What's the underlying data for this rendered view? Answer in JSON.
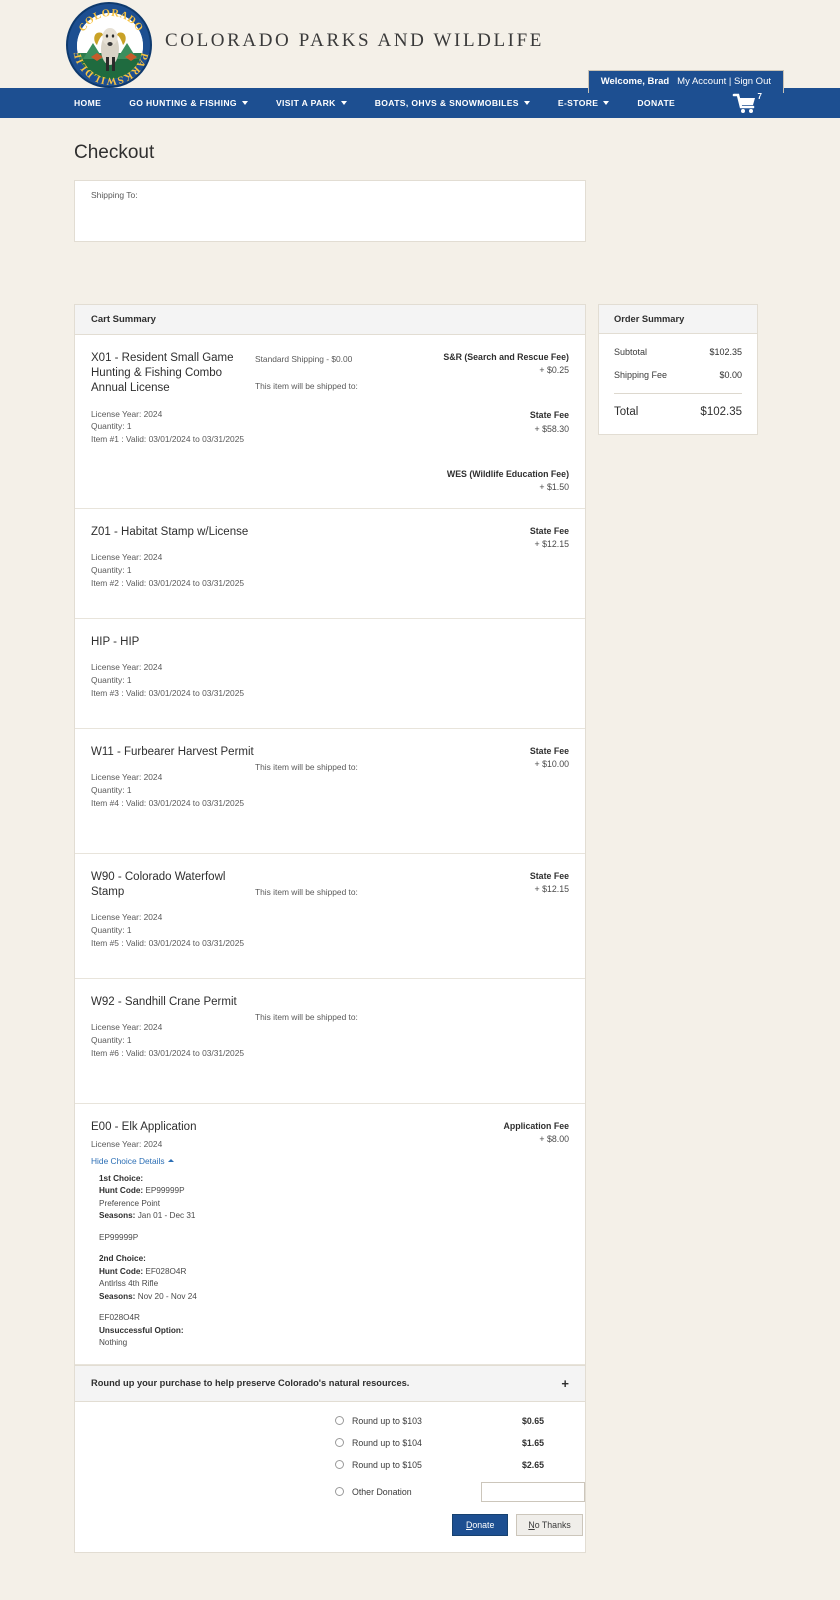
{
  "header": {
    "brand_title": "COLORADO PARKS AND WILDLIFE",
    "logo_alt": "colorado-parks-wildlife-seal",
    "logo_text_top": "COLORADO",
    "logo_text_left": "PARKS",
    "logo_text_right": "WILDLIFE",
    "welcome_name": "Welcome, Brad",
    "welcome_links": "My Account | Sign Out",
    "cart_count": "7"
  },
  "nav": {
    "items": [
      {
        "label": "HOME",
        "has_caret": false
      },
      {
        "label": "GO HUNTING & FISHING",
        "has_caret": true
      },
      {
        "label": "VISIT A PARK",
        "has_caret": true
      },
      {
        "label": "BOATS, OHVS & SNOWMOBILES",
        "has_caret": true
      },
      {
        "label": "E-STORE",
        "has_caret": true
      },
      {
        "label": "DONATE",
        "has_caret": false
      }
    ]
  },
  "page": {
    "title": "Checkout",
    "shipping_to_label": "Shipping To:"
  },
  "cart": {
    "header": "Cart Summary",
    "items": [
      {
        "name": "X01 - Resident Small Game Hunting & Fishing Combo Annual License",
        "license_year": "License Year: 2024",
        "quantity": "Quantity: 1",
        "valid": "Item #1 : Valid: 03/01/2024 to 03/31/2025",
        "shipping_method": "Standard Shipping - $0.00",
        "shipped_to": "This item will be shipped to:",
        "fees": [
          {
            "label": "S&R (Search and Rescue Fee)",
            "amount": "+ $0.25"
          },
          {
            "label": "State Fee",
            "amount": "+ $58.30"
          },
          {
            "label": "WES (Wildlife Education Fee)",
            "amount": "+ $1.50"
          }
        ]
      },
      {
        "name": "Z01 - Habitat Stamp w/License",
        "license_year": "License Year: 2024",
        "quantity": "Quantity: 1",
        "valid": "Item #2 : Valid: 03/01/2024 to 03/31/2025",
        "shipping_method": "",
        "shipped_to": "",
        "fees": [
          {
            "label": "State Fee",
            "amount": "+ $12.15"
          }
        ]
      },
      {
        "name": "HIP - HIP",
        "license_year": "License Year: 2024",
        "quantity": "Quantity: 1",
        "valid": "Item #3 : Valid: 03/01/2024 to 03/31/2025",
        "shipping_method": "",
        "shipped_to": "",
        "fees": []
      },
      {
        "name": "W11 - Furbearer Harvest Permit",
        "license_year": "License Year: 2024",
        "quantity": "Quantity: 1",
        "valid": "Item #4 : Valid: 03/01/2024 to 03/31/2025",
        "shipping_method": "",
        "shipped_to": "This item will be shipped to:",
        "fees": [
          {
            "label": "State Fee",
            "amount": "+ $10.00"
          }
        ]
      },
      {
        "name": "W90 - Colorado Waterfowl Stamp",
        "license_year": "License Year: 2024",
        "quantity": "Quantity: 1",
        "valid": "Item #5 : Valid: 03/01/2024 to 03/31/2025",
        "shipping_method": "",
        "shipped_to": "This item will be shipped to:",
        "fees": [
          {
            "label": "State Fee",
            "amount": "+ $12.15"
          }
        ]
      },
      {
        "name": "W92 - Sandhill Crane Permit",
        "license_year": "License Year: 2024",
        "quantity": "Quantity: 1",
        "valid": "Item #6 : Valid: 03/01/2024 to 03/31/2025",
        "shipping_method": "",
        "shipped_to": "This item will be shipped to:",
        "fees": []
      }
    ],
    "application": {
      "name": "E00 - Elk Application",
      "license_year": "License Year: 2024",
      "toggle_label": "Hide Choice Details",
      "fee_label": "Application Fee",
      "fee_amount": "+ $8.00",
      "choices": [
        {
          "title": "1st Choice:",
          "hunt_code_label": "Hunt Code:",
          "hunt_code": "EP99999P",
          "description": "Preference Point",
          "seasons_label": "Seasons:",
          "seasons": "Jan 01 - Dec 31",
          "code_repeat": "EP99999P"
        },
        {
          "title": "2nd Choice:",
          "hunt_code_label": "Hunt Code:",
          "hunt_code": "EF028O4R",
          "description": "Antlrlss 4th Rifle",
          "seasons_label": "Seasons:",
          "seasons": "Nov 20 - Nov 24",
          "code_repeat": "EF028O4R"
        }
      ],
      "unsuccessful_label": "Unsuccessful Option:",
      "unsuccessful_value": "Nothing"
    }
  },
  "donation": {
    "header": "Round up your purchase to help preserve Colorado's natural resources.",
    "expand_icon": "+",
    "options": [
      {
        "label": "Round up to $103",
        "amount": "$0.65"
      },
      {
        "label": "Round up to $104",
        "amount": "$1.65"
      },
      {
        "label": "Round up to $105",
        "amount": "$2.65"
      }
    ],
    "other_label": "Other Donation",
    "other_value": "",
    "donate_button": "Donate",
    "no_thanks_button": "No Thanks"
  },
  "order_summary": {
    "header": "Order Summary",
    "subtotal_label": "Subtotal",
    "subtotal_value": "$102.35",
    "shipping_label": "Shipping Fee",
    "shipping_value": "$0.00",
    "total_label": "Total",
    "total_value": "$102.35"
  },
  "colors": {
    "brand_blue": "#1d4f91",
    "page_bg": "#f4f0e8",
    "panel_bg": "#ffffff",
    "link_blue": "#2c6fb5",
    "logo_gold": "#f5c242"
  }
}
